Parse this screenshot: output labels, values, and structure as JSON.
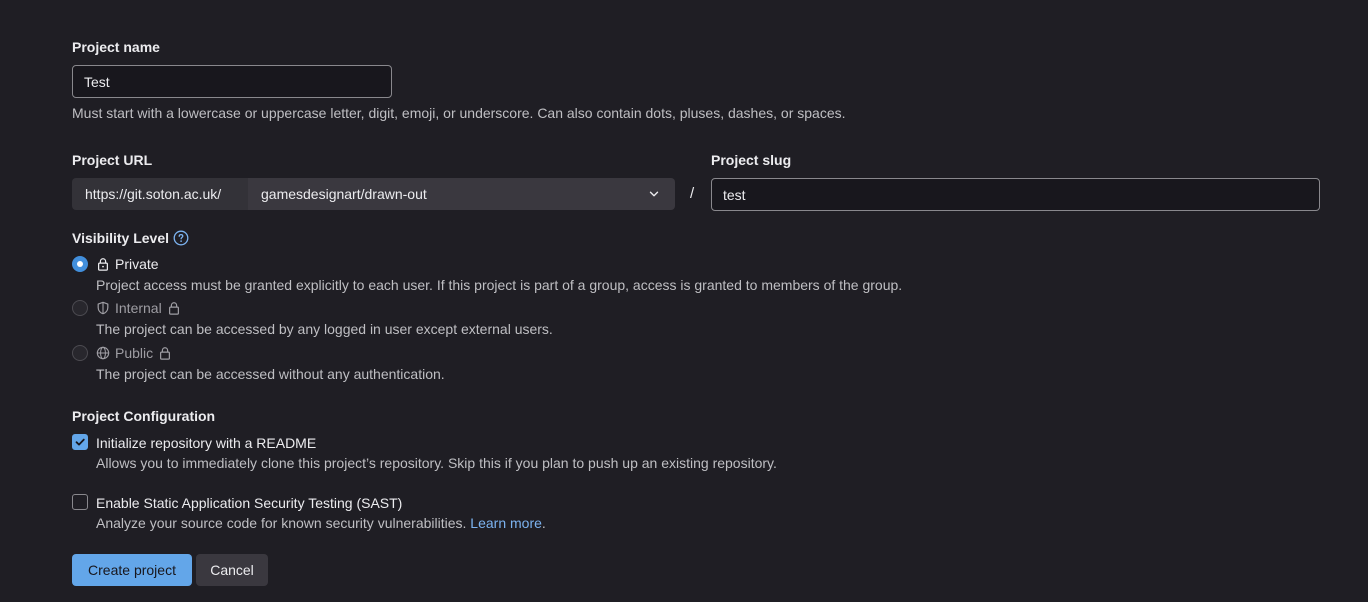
{
  "project_name": {
    "label": "Project name",
    "value": "Test",
    "help": "Must start with a lowercase or uppercase letter, digit, emoji, or underscore. Can also contain dots, pluses, dashes, or spaces."
  },
  "project_url": {
    "label": "Project URL",
    "prefix": "https://git.soton.ac.uk/",
    "namespace": "gamesdesignart/drawn-out",
    "separator": "/"
  },
  "project_slug": {
    "label": "Project slug",
    "value": "test"
  },
  "visibility": {
    "label": "Visibility Level",
    "icon": "question-circle-icon",
    "options": [
      {
        "label": "Private",
        "icon": "lock-icon",
        "selected": true,
        "disabled": false,
        "description": "Project access must be granted explicitly to each user. If this project is part of a group, access is granted to members of the group."
      },
      {
        "label": "Internal",
        "icon": "shield-icon",
        "selected": false,
        "disabled": true,
        "description": "The project can be accessed by any logged in user except external users."
      },
      {
        "label": "Public",
        "icon": "globe-icon",
        "selected": false,
        "disabled": true,
        "description": "The project can be accessed without any authentication."
      }
    ]
  },
  "configuration": {
    "label": "Project Configuration",
    "options": [
      {
        "label": "Initialize repository with a README",
        "checked": true,
        "description": "Allows you to immediately clone this project’s repository. Skip this if you plan to push up an existing repository."
      },
      {
        "label": "Enable Static Application Security Testing (SAST)",
        "checked": false,
        "description": "Analyze your source code for known security vulnerabilities.",
        "link": "Learn more"
      }
    ]
  },
  "buttons": {
    "create": "Create project",
    "cancel": "Cancel"
  },
  "colors": {
    "background": "#1f1e24",
    "primary": "#63a6e9",
    "radio_selected": "#428fdc",
    "link": "#7cb3f0"
  }
}
